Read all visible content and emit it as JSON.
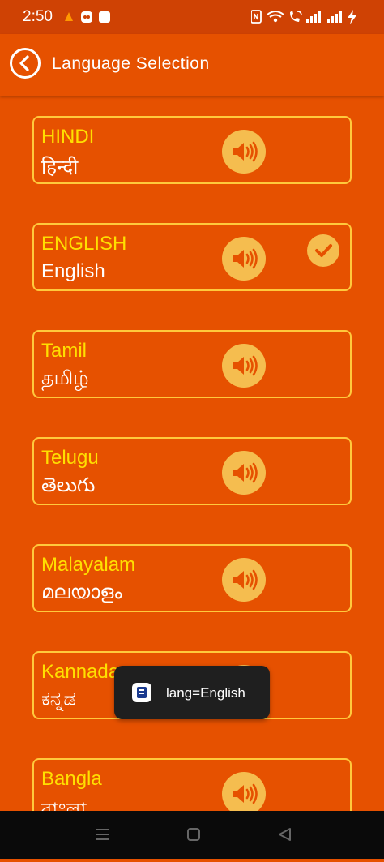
{
  "status_bar": {
    "time": "2:50",
    "left_icons": [
      "vlc-icon",
      "app-icon",
      "square-icon"
    ],
    "right_icons": [
      "nfc-icon",
      "wifi-icon",
      "wifi-calling-icon",
      "signal-1-icon",
      "signal-2-icon",
      "charging-icon"
    ]
  },
  "app_bar": {
    "title": "Language Selection",
    "back_icon": "back-circle-icon"
  },
  "languages": [
    {
      "name": "HINDI",
      "native": "हिन्दी",
      "selected": false
    },
    {
      "name": "ENGLISH",
      "native": "English",
      "selected": true
    },
    {
      "name": "Tamil",
      "native": "தமிழ்",
      "selected": false
    },
    {
      "name": "Telugu",
      "native": "తెలుగు",
      "selected": false
    },
    {
      "name": "Malayalam",
      "native": "മലയാളം",
      "selected": false
    },
    {
      "name": "Kannada",
      "native": "ಕನ್ನಡ",
      "selected": false
    },
    {
      "name": "Bangla",
      "native": "বাংলা",
      "selected": false
    }
  ],
  "toast": {
    "message": "lang=English"
  },
  "colors": {
    "background": "#e65100",
    "status_bar": "#cf4204",
    "card_border": "#ffc93c",
    "language_name": "#ffe000",
    "button_fill": "#f5bd4f",
    "icon_color": "#e65100"
  }
}
